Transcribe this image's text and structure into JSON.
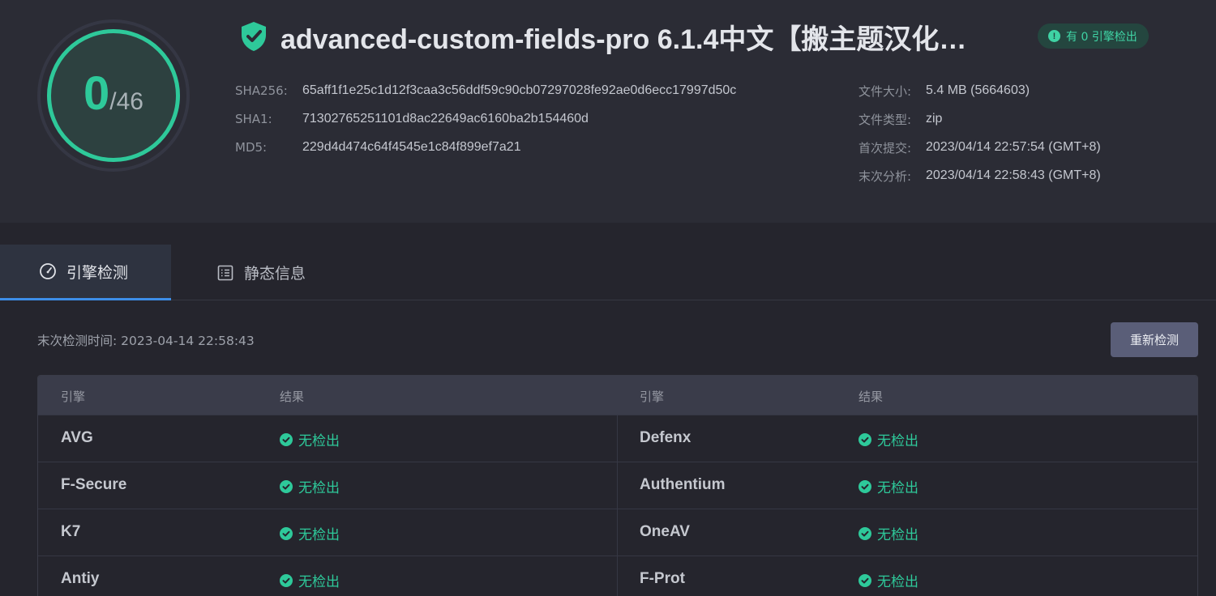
{
  "score": {
    "detected": "0",
    "total": "/46"
  },
  "file": {
    "title": "advanced-custom-fields-pro 6.1.4中文【搬主题汉化…",
    "badge": "有 0 引擎检出"
  },
  "hashes": [
    {
      "label": "SHA256:",
      "value": "65aff1f1e25c1d12f3caa3c56ddf59c90cb07297028fe92ae0d6ecc17997d50c"
    },
    {
      "label": "SHA1:",
      "value": "71302765251101d8ac22649ac6160ba2b154460d"
    },
    {
      "label": "MD5:",
      "value": "229d4d474c64f4545e1c84f899ef7a21"
    }
  ],
  "meta": [
    {
      "label": "文件大小:",
      "value": "5.4 MB (5664603)"
    },
    {
      "label": "文件类型:",
      "value": "zip"
    },
    {
      "label": "首次提交:",
      "value": "2023/04/14 22:57:54 (GMT+8)"
    },
    {
      "label": "末次分析:",
      "value": "2023/04/14 22:58:43 (GMT+8)"
    }
  ],
  "tabs": [
    {
      "label": "引擎检测",
      "icon": "gauge-icon",
      "active": true
    },
    {
      "label": "静态信息",
      "icon": "document-list-icon",
      "active": false
    }
  ],
  "toolbar": {
    "last_scan": "末次检测时间: 2023-04-14 22:58:43",
    "rescan_label": "重新检测"
  },
  "table": {
    "headers": [
      "引擎",
      "结果",
      "引擎",
      "结果"
    ],
    "rows": [
      {
        "left_engine": "AVG",
        "left_result": "无检出",
        "right_engine": "Defenx",
        "right_result": "无检出"
      },
      {
        "left_engine": "F-Secure",
        "left_result": "无检出",
        "right_engine": "Authentium",
        "right_result": "无检出"
      },
      {
        "left_engine": "K7",
        "left_result": "无检出",
        "right_engine": "OneAV",
        "right_result": "无检出"
      },
      {
        "left_engine": "Antiy",
        "left_result": "无检出",
        "right_engine": "F-Prot",
        "right_result": "无检出"
      }
    ]
  },
  "colors": {
    "accent_green": "#2ec99a",
    "tab_active": "#3d8ee8",
    "button": "#5a5e78"
  }
}
